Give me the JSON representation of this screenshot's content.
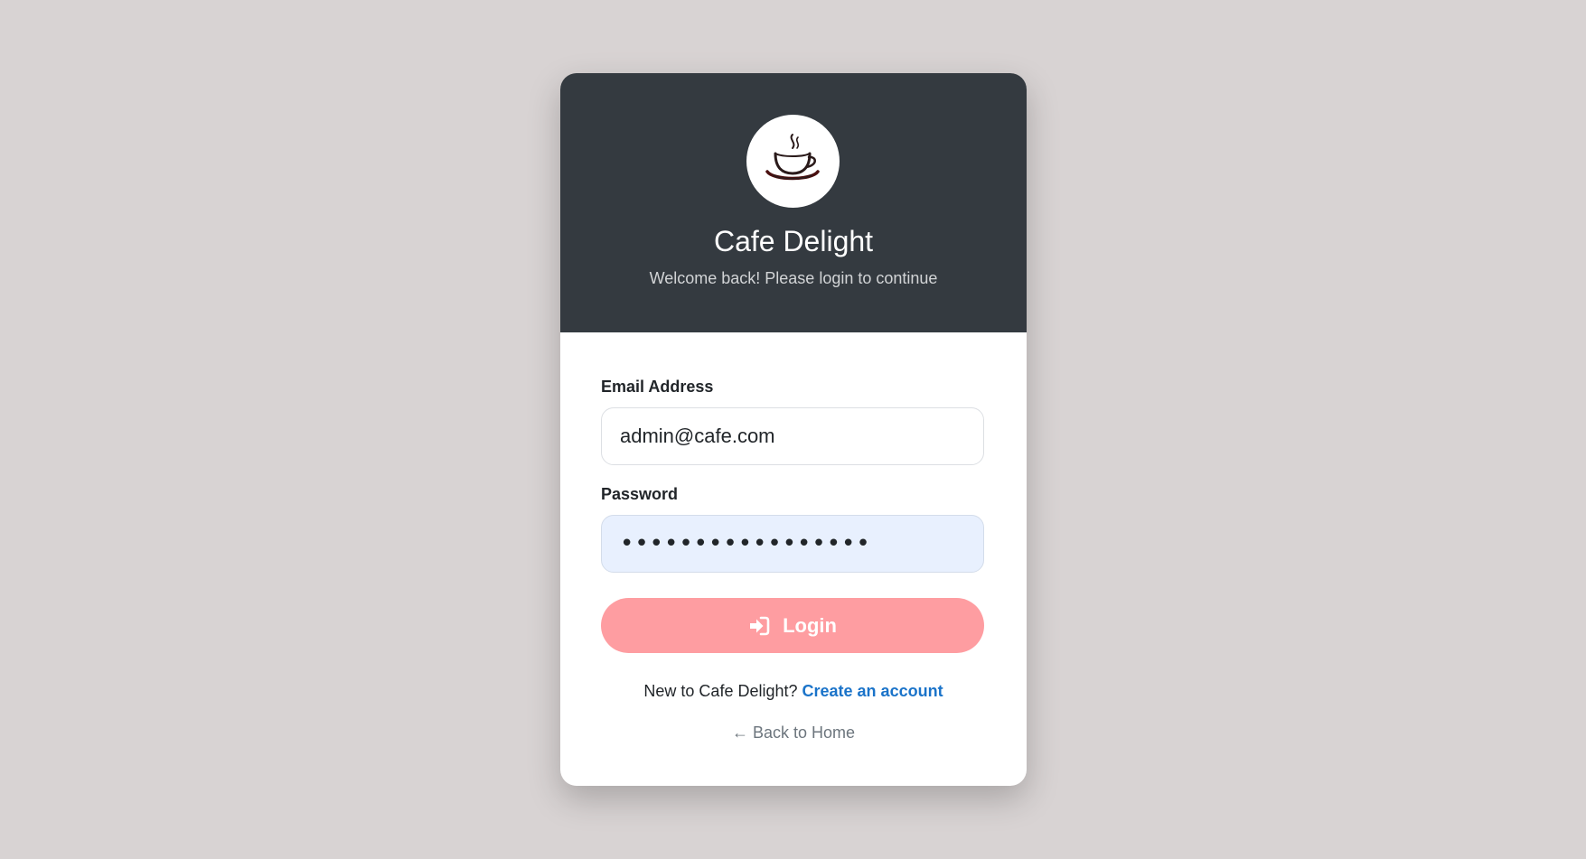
{
  "brand": {
    "title": "Cafe Delight",
    "subtitle": "Welcome back! Please login to continue",
    "logo_icon": "coffee-cup-icon"
  },
  "form": {
    "email_label": "Email Address",
    "email_value": "admin@cafe.com",
    "password_label": "Password",
    "password_masked": "•••••••••••••••••",
    "login_label": "Login",
    "login_icon": "sign-in-icon"
  },
  "footer": {
    "signup_prompt": "New to Cafe Delight?",
    "signup_link": "Create an account",
    "back_link": "← Back to Home"
  },
  "colors": {
    "background": "#d8d3d3",
    "header": "#343a40",
    "login_button": "#fe9da1",
    "link": "#1a73c9",
    "password_field": "#e8f0fe"
  }
}
